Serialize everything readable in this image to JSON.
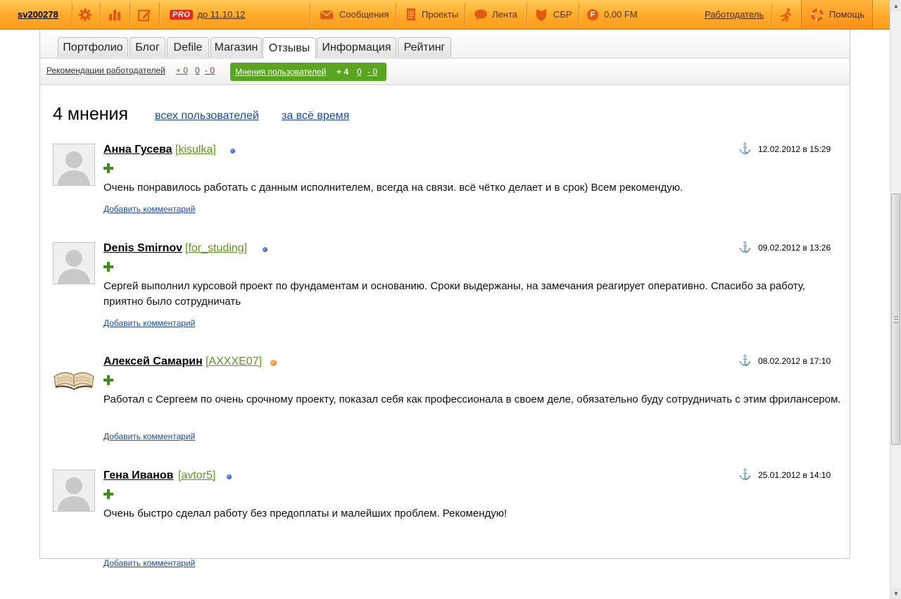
{
  "topbar": {
    "username": "sv200278",
    "pro_badge": "PRO",
    "pro_until": "до 11.10.12",
    "messages": "Сообщения",
    "projects": "Проекты",
    "feed": "Лента",
    "sbr": "СБР",
    "balance": "0,00 FM",
    "fm_letter": "F",
    "employer": "Работодатель",
    "help": "Помощь"
  },
  "tabs": [
    {
      "label": "Портфолио"
    },
    {
      "label": "Блог"
    },
    {
      "label": "Defile"
    },
    {
      "label": "Магазин"
    },
    {
      "label": "Отзывы"
    },
    {
      "label": "Информация"
    },
    {
      "label": "Рейтинг"
    }
  ],
  "subnav": {
    "employers_label": "Рекомендации работодателей",
    "employers_pos": "+ 0",
    "employers_neu": "0",
    "employers_neg": "- 0",
    "users_label": "Мнения пользователей",
    "users_pos": "+ 4",
    "users_neu": "0",
    "users_neg": "- 0"
  },
  "heading": "4 мнения",
  "filters": {
    "users": "всех пользователей",
    "period": "за всё время"
  },
  "reviews": [
    {
      "name": "Анна Гусева",
      "login": "[kisulka]",
      "date": "12.02.2012 в 15:29",
      "text": "Очень понравилось работать с данным исполнителем, всегда на связи. всё чётко делает и в срок) Всем рекомендую.",
      "add_comment": "Добавить комментарий"
    },
    {
      "name": "Denis Smirnov",
      "login": "[for_studing]",
      "date": "09.02.2012 в 13:26",
      "text": "Сергей выполнил курсовой проект по фундаментам и основанию. Сроки выдержаны, на замечания реагирует оперативно. Спасибо за работу, приятно было сотрудничать",
      "add_comment": "Добавить комментарий"
    },
    {
      "name": "Алексей Самарин",
      "login": "[AXXXE07]",
      "date": "08.02.2012 в 17:10",
      "text": "Работал с Сергеем по очень срочному проекту, показал себя как профессионала в своем деле, обязательно буду сотрудничать с этим фрилансером.",
      "add_comment": "Добавить комментарий"
    },
    {
      "name": "Гена Иванов",
      "login": "[avtor5]",
      "date": "25.01.2012 в 14:10",
      "text": "Очень быстро сделал работу без предоплаты и малейших проблем. Рекомендую!",
      "add_comment": "Добавить комментарий"
    }
  ],
  "colors": {
    "topbar": "#ffa92a",
    "active_filter": "#5aa520",
    "login": "#5a9a1a",
    "link": "#1a4c99"
  }
}
